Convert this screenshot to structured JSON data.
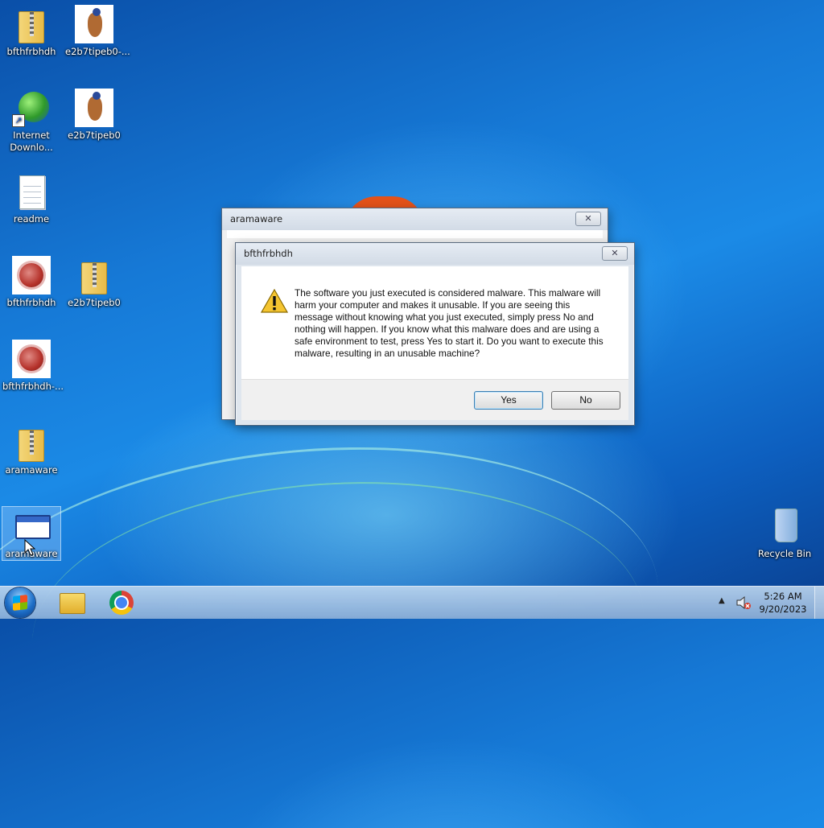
{
  "desktop": {
    "icons": [
      {
        "label": "bfthfrbhdh",
        "type": "zip-folder"
      },
      {
        "label": "e2b7tipeb0-...",
        "type": "bird-image"
      },
      {
        "label": "Internet Downlo...",
        "type": "idm-shortcut"
      },
      {
        "label": "e2b7tipeb0",
        "type": "bird-image"
      },
      {
        "label": "readme",
        "type": "text-document"
      },
      {
        "label": "bfthfrbhdh",
        "type": "virus-image"
      },
      {
        "label": "e2b7tipeb0",
        "type": "zip-folder"
      },
      {
        "label": "bfthfrbhdh-...",
        "type": "virus-image"
      },
      {
        "label": "aramaware",
        "type": "zip-folder"
      },
      {
        "label": "aramaware",
        "type": "application-window"
      },
      {
        "label": "Recycle Bin",
        "type": "recycle-bin"
      }
    ]
  },
  "dialogs": {
    "background": {
      "title": "aramaware",
      "close_label": "✕"
    },
    "foreground": {
      "title": "bfthfrbhdh",
      "close_label": "✕",
      "message": "The software you just executed is considered malware. This malware will harm your computer and makes it unusable. If you are seeing this message without knowing what you just executed, simply press No and nothing will happen. If you know what this malware does and are using a safe environment to test, press Yes to start it. Do you want to execute this malware, resulting in an unusable machine?",
      "icon": "warning-icon",
      "yes_label": "Yes",
      "no_label": "No"
    }
  },
  "taskbar": {
    "start_icon": "windows-start-orb",
    "pinned": [
      {
        "name": "windows-explorer",
        "icon": "folder-icon"
      },
      {
        "name": "google-chrome",
        "icon": "chrome-icon"
      }
    ],
    "tray": {
      "show_hidden_label": "▲",
      "volume_icon": "speaker-muted-icon",
      "time": "5:26 AM",
      "date": "9/20/2023"
    }
  },
  "colors": {
    "accent": "#1679d6",
    "dialog_background": "#f0f0f0",
    "default_button_border": "#3c7fb1"
  }
}
